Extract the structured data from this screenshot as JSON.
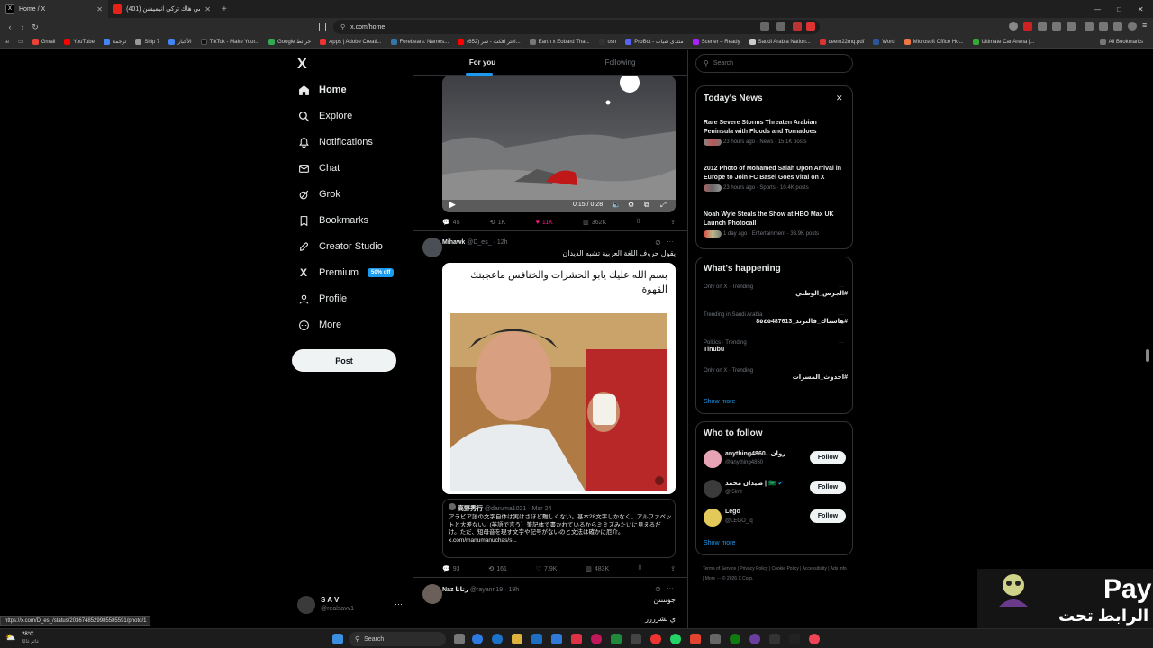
{
  "browser": {
    "tabs": [
      {
        "title": "Home / X",
        "active": true
      },
      {
        "title": "(401) ويرك سي هاك تركي انيميشن",
        "active": false
      }
    ],
    "new_tab": "+",
    "url": "x.com/home",
    "window_controls": [
      "—",
      "□",
      "✕"
    ],
    "bookmarks": [
      "Gmail",
      "YouTube",
      "ترجمة",
      "Ship 7",
      "الأخبار",
      "TikTok - Make Your...",
      "Google خرائط",
      "Apps | Adobe Creati...",
      "Forebears: Names...",
      "(652) افتر افكت - شر...",
      "Earth x Eobard Tha...",
      "osn",
      "ProBot - منتدى شباب",
      "Scener – Ready",
      "Saudi Arabia Nation...",
      "ceem22mq.pdf",
      "Word",
      "Microsoft Office Ho...",
      "Ultimate Car Arena |..."
    ],
    "all_bookmarks": "All Bookmarks",
    "status_url": "https://x.com/D_es_/status/2036748529985585591/photo/1"
  },
  "nav": {
    "logo": "X",
    "items": [
      {
        "label": "Home",
        "icon": "home-icon"
      },
      {
        "label": "Explore",
        "icon": "search-icon"
      },
      {
        "label": "Notifications",
        "icon": "bell-icon"
      },
      {
        "label": "Chat",
        "icon": "mail-icon"
      },
      {
        "label": "Grok",
        "icon": "grok-icon"
      },
      {
        "label": "Bookmarks",
        "icon": "bookmark-icon"
      },
      {
        "label": "Creator Studio",
        "icon": "rocket-icon"
      },
      {
        "label": "Premium",
        "icon": "x-icon",
        "badge": "50% off"
      },
      {
        "label": "Profile",
        "icon": "person-icon"
      },
      {
        "label": "More",
        "icon": "more-circle-icon"
      }
    ],
    "post_label": "Post",
    "account": {
      "name": "S A V",
      "handle": "@realsavv1"
    }
  },
  "timeline": {
    "tabs": [
      "For you",
      "Following"
    ],
    "video_tweet": {
      "time": "0:15 / 0:28",
      "replies": "45",
      "reposts": "1K",
      "likes": "11K",
      "views": "362K"
    },
    "tweet2": {
      "name": "Mihawk",
      "handle": "@D_es_",
      "age": "12h",
      "text": "يقول حروف اللغة العربية تشبه الديدان",
      "image_caption": "بسم الله عليك يابو الحشرات والخنافس ماعجبتك القهوة",
      "quote": {
        "name": "高野秀行",
        "handle": "@daruma1021",
        "date": "Mar 24",
        "text": "アラビア語の文字自体は実はさほど難しくない。基本28文字しかなく、アルファベットと大差ない。(英語で言う）筆記体で書かれているからミミズみたいに見えるだけ。ただ、短母音を現す文字や記号がないのと文法は確かに厄介。 x.com/manumanuchas/s..."
      },
      "replies": "93",
      "reposts": "161",
      "likes": "7.9K",
      "views": "483K"
    },
    "tweet3": {
      "name": "Naz رتانا",
      "handle": "@rayann19",
      "age": "19h",
      "line1": "جوننتتن",
      "line2": "ي بشرررر"
    }
  },
  "sidebar": {
    "search_placeholder": "Search",
    "news": {
      "title": "Today's News",
      "items": [
        {
          "headline": "Rare Severe Storms Threaten Arabian Peninsula with Floods and Tornadoes",
          "meta": "23 hours ago · News · 15.1K posts"
        },
        {
          "headline": "2012 Photo of Mohamed Salah Upon Arrival in Europe to Join FC Basel Goes Viral on X",
          "meta": "23 hours ago · Sports · 10.4K posts"
        },
        {
          "headline": "Noah Wyle Steals the Show at HBO Max UK Launch Photocall",
          "meta": "1 day ago · Entertainment · 33.9K posts"
        }
      ]
    },
    "happening": {
      "title": "What's happening",
      "items": [
        {
          "context": "Only on X · Trending",
          "topic": "#الجرس_الوطني"
        },
        {
          "context": "Trending in Saudi Arabia",
          "topic": "#هاشتاك_فالترند_8٥٤٥487613"
        },
        {
          "context": "Politics · Trending",
          "topic": "Tinubu"
        },
        {
          "context": "Only on X · Trending",
          "topic": "#احدوث_المسرات"
        }
      ],
      "show_more": "Show more"
    },
    "who_to_follow": {
      "title": "Who to follow",
      "items": [
        {
          "name": "anything4860...ﺭﻭﺍﻥ",
          "handle": "@anything4860",
          "btn": "Follow"
        },
        {
          "name": "ضيدان محمد | 🇸🇦",
          "handle": "@l5lmt",
          "btn": "Follow"
        },
        {
          "name": "Lego",
          "handle": "@LEGO_lq",
          "btn": "Follow"
        }
      ],
      "show_more": "Show more"
    },
    "footer": "Terms of Service  |  Privacy Policy  |  Cookie Policy  |  Accessibility  |  Ads info  |  More ···  © 2026 X Corp."
  },
  "overlay": {
    "pay_text": "Pay",
    "arabic_text": "الرابط تحت"
  },
  "taskbar": {
    "weather_temp": "28°C",
    "weather_desc": "غائم غالبًا",
    "search_label": "Search"
  },
  "colors": {
    "accent": "#1d9bf0",
    "like": "#f91880",
    "premium": "#1d9bf0"
  }
}
